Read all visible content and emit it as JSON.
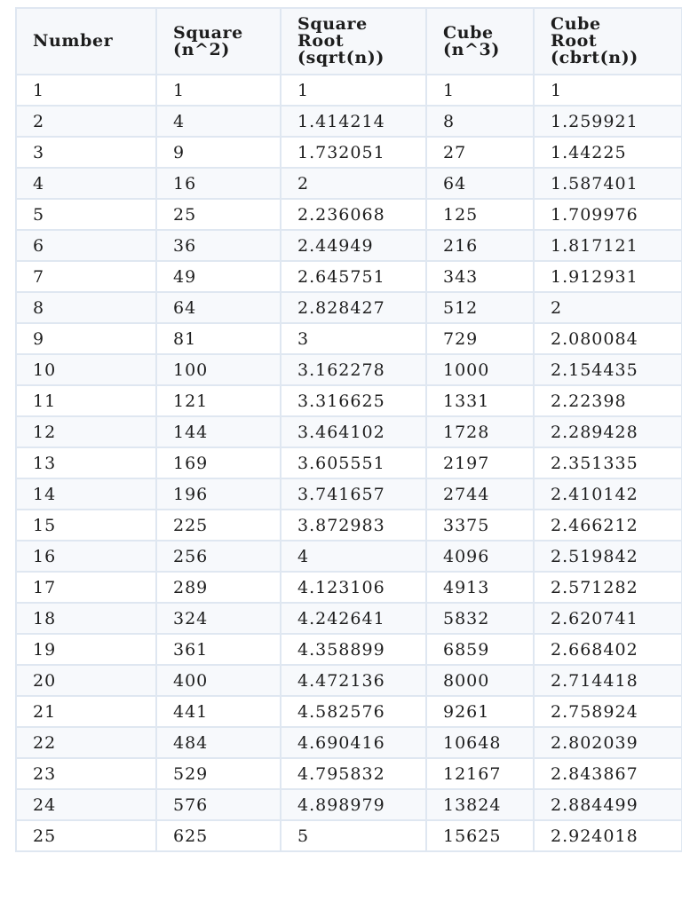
{
  "table": {
    "headers": [
      "Number",
      "Square\n(n^2)",
      "Square\nRoot\n(sqrt(n))",
      "Cube\n(n^3)",
      "Cube\nRoot\n(cbrt(n))"
    ],
    "rows": [
      [
        "1",
        "1",
        "1",
        "1",
        "1"
      ],
      [
        "2",
        "4",
        "1.414214",
        "8",
        "1.259921"
      ],
      [
        "3",
        "9",
        "1.732051",
        "27",
        "1.44225"
      ],
      [
        "4",
        "16",
        "2",
        "64",
        "1.587401"
      ],
      [
        "5",
        "25",
        "2.236068",
        "125",
        "1.709976"
      ],
      [
        "6",
        "36",
        "2.44949",
        "216",
        "1.817121"
      ],
      [
        "7",
        "49",
        "2.645751",
        "343",
        "1.912931"
      ],
      [
        "8",
        "64",
        "2.828427",
        "512",
        "2"
      ],
      [
        "9",
        "81",
        "3",
        "729",
        "2.080084"
      ],
      [
        "10",
        "100",
        "3.162278",
        "1000",
        "2.154435"
      ],
      [
        "11",
        "121",
        "3.316625",
        "1331",
        "2.22398"
      ],
      [
        "12",
        "144",
        "3.464102",
        "1728",
        "2.289428"
      ],
      [
        "13",
        "169",
        "3.605551",
        "2197",
        "2.351335"
      ],
      [
        "14",
        "196",
        "3.741657",
        "2744",
        "2.410142"
      ],
      [
        "15",
        "225",
        "3.872983",
        "3375",
        "2.466212"
      ],
      [
        "16",
        "256",
        "4",
        "4096",
        "2.519842"
      ],
      [
        "17",
        "289",
        "4.123106",
        "4913",
        "2.571282"
      ],
      [
        "18",
        "324",
        "4.242641",
        "5832",
        "2.620741"
      ],
      [
        "19",
        "361",
        "4.358899",
        "6859",
        "2.668402"
      ],
      [
        "20",
        "400",
        "4.472136",
        "8000",
        "2.714418"
      ],
      [
        "21",
        "441",
        "4.582576",
        "9261",
        "2.758924"
      ],
      [
        "22",
        "484",
        "4.690416",
        "10648",
        "2.802039"
      ],
      [
        "23",
        "529",
        "4.795832",
        "12167",
        "2.843867"
      ],
      [
        "24",
        "576",
        "4.898979",
        "13824",
        "2.884499"
      ],
      [
        "25",
        "625",
        "5",
        "15625",
        "2.924018"
      ]
    ]
  },
  "colors": {
    "border": "#dfe7f1",
    "header_bg": "#f6f8fb",
    "stripe_bg": "#f7f9fc",
    "text": "#1d1d1d"
  }
}
